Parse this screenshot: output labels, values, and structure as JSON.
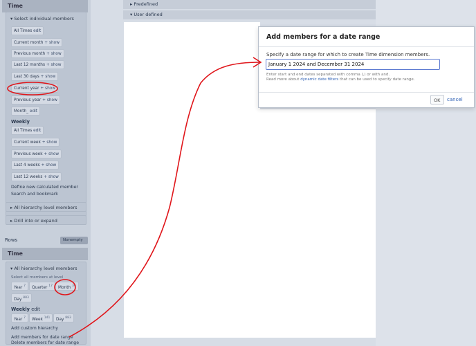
{
  "left": {
    "time_header": "Time",
    "select_individual": "Select individual members",
    "chips": [
      {
        "label": "All Times",
        "action": "edit"
      },
      {
        "label": "Current month",
        "action": "show"
      },
      {
        "label": "Previous month",
        "action": "show"
      },
      {
        "label": "Last 12 months",
        "action": "show"
      },
      {
        "label": "Last 30 days",
        "action": "show"
      },
      {
        "label": "Current year",
        "action": "show"
      },
      {
        "label": "Previous year",
        "action": "show"
      },
      {
        "label": "Month_",
        "action": "edit"
      }
    ],
    "weekly_label": "Weekly",
    "weekly_chips": [
      {
        "label": "All Times",
        "action": "edit"
      },
      {
        "label": "Current week",
        "action": "show"
      },
      {
        "label": "Previous week",
        "action": "show"
      },
      {
        "label": "Last 4 weeks",
        "action": "show"
      },
      {
        "label": "Last 12 weeks",
        "action": "show"
      }
    ],
    "define_calc": "Define new calculated member",
    "search_bookmark": "Search and bookmark",
    "all_hierarchy": "All hierarchy level members",
    "drill": "Drill into or expand",
    "rows_label": "Rows",
    "nonempty": "Nonempty",
    "rows_time_header": "Time",
    "rows_all_hierarchy": "All hierarchy level members",
    "select_all_level": "Select all members at level",
    "levels": [
      {
        "label": "Year",
        "count": "7"
      },
      {
        "label": "Quarter",
        "count": "17"
      },
      {
        "label": "Month",
        "count": "36"
      },
      {
        "label": "Day",
        "count": "883"
      }
    ],
    "weekly2_label": "Weekly",
    "weekly2_edit": "edit",
    "weekly_levels": [
      {
        "label": "Year",
        "count": "7"
      },
      {
        "label": "Week",
        "count": "141"
      },
      {
        "label": "Day",
        "count": "883"
      }
    ],
    "add_custom_hierarchy": "Add custom hierarchy",
    "add_members_range": "Add members for date range",
    "delete_members_range": "Delete members for date range"
  },
  "middle": {
    "predefined": "Predefined",
    "user_defined": "User defined"
  },
  "dialog": {
    "title": "Add members for a date range",
    "prompt": "Specify a date range for which to create Time dimension members.",
    "input_value": "January 1 2024 and December 31 2024",
    "help1": "Enter start and end dates separated with comma (,) or with and.",
    "help2_pre": "Read more about ",
    "help2_link": "dynamic date filters",
    "help2_post": " that can be used to specify date range.",
    "ok": "OK",
    "cancel": "cancel"
  },
  "colors": {
    "annotation": "#e0161b",
    "link": "#2f61b5",
    "panel": "#c8d0db"
  }
}
